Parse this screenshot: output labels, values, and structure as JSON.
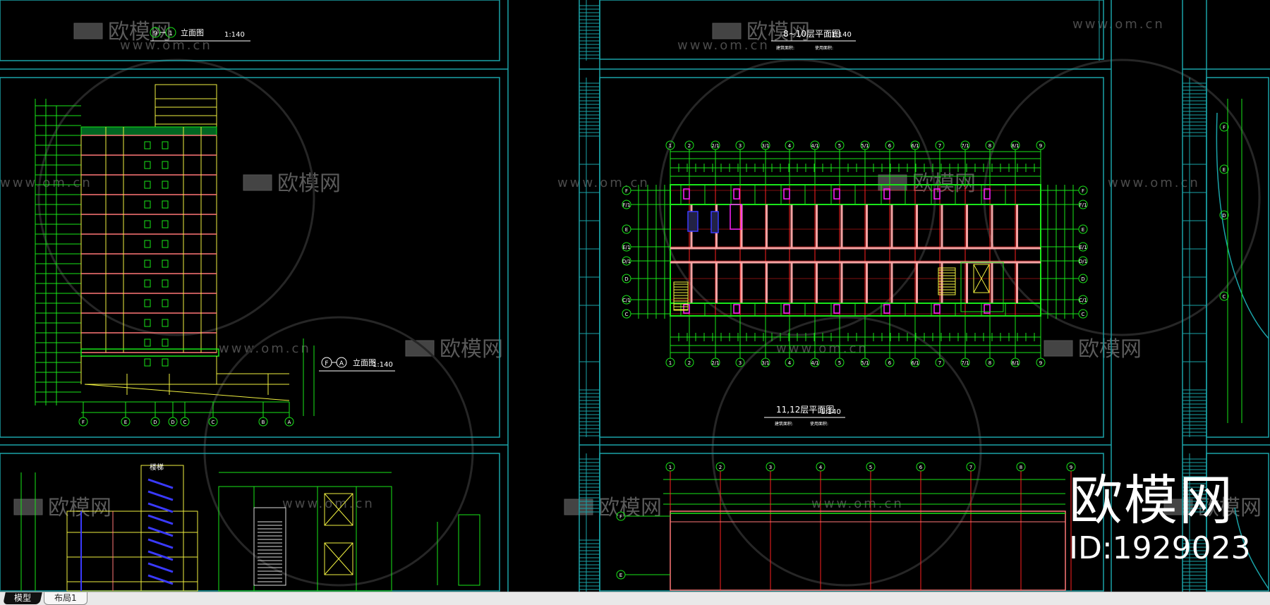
{
  "sheets": {
    "elevation_top": {
      "title": "9—1 立面图",
      "axis_from": "9",
      "axis_to": "1",
      "label": "立面图",
      "scale": "1:140"
    },
    "elevation_side": {
      "title": "F—A 立面图",
      "axis_from": "F",
      "axis_to": "A",
      "label": "立面图",
      "scale": "1:140",
      "bottom_axes": [
        "F",
        "E",
        "D",
        "D",
        "C",
        "C",
        "B",
        "A"
      ]
    },
    "plan_top": {
      "title": "8~10层平面图",
      "scale": "1:140",
      "note1": "建筑面积:",
      "note2": "使用面积:"
    },
    "plan_main": {
      "title": "11,12层平面图",
      "scale": "1:140",
      "note1": "建筑面积:",
      "note2": "使用面积:",
      "top_axes": [
        "1",
        "2",
        "2/1",
        "3",
        "3/1",
        "4",
        "4/1",
        "5",
        "5/1",
        "6",
        "6/1",
        "7",
        "7/1",
        "8",
        "8/1",
        "9"
      ],
      "left_axes": [
        "F",
        "F/1",
        "E",
        "E/1",
        "D/1",
        "D",
        "C/1",
        "C"
      ]
    },
    "roof_plan": {
      "top_axes": [
        "1",
        "2",
        "3",
        "4",
        "5",
        "6",
        "7",
        "8",
        "9"
      ],
      "left_axes": [
        "F",
        "E"
      ]
    },
    "stair_section": {
      "label": "楼梯"
    }
  },
  "watermark": {
    "brand": "欧模网",
    "url": "www.om.cn",
    "big_brand": "欧模网",
    "id": "ID:1929023"
  },
  "tabs": [
    {
      "label": "模型",
      "active": true
    },
    {
      "label": "布局1",
      "active": false
    }
  ],
  "colors": {
    "frame": "#1aa3a8",
    "line": "#19e619",
    "wall": "#f5a3a3",
    "axis": "#ff2020",
    "yellow": "#f0f040",
    "magenta": "#ff20ff",
    "blue": "#3a3aff",
    "white": "#ffffff"
  }
}
